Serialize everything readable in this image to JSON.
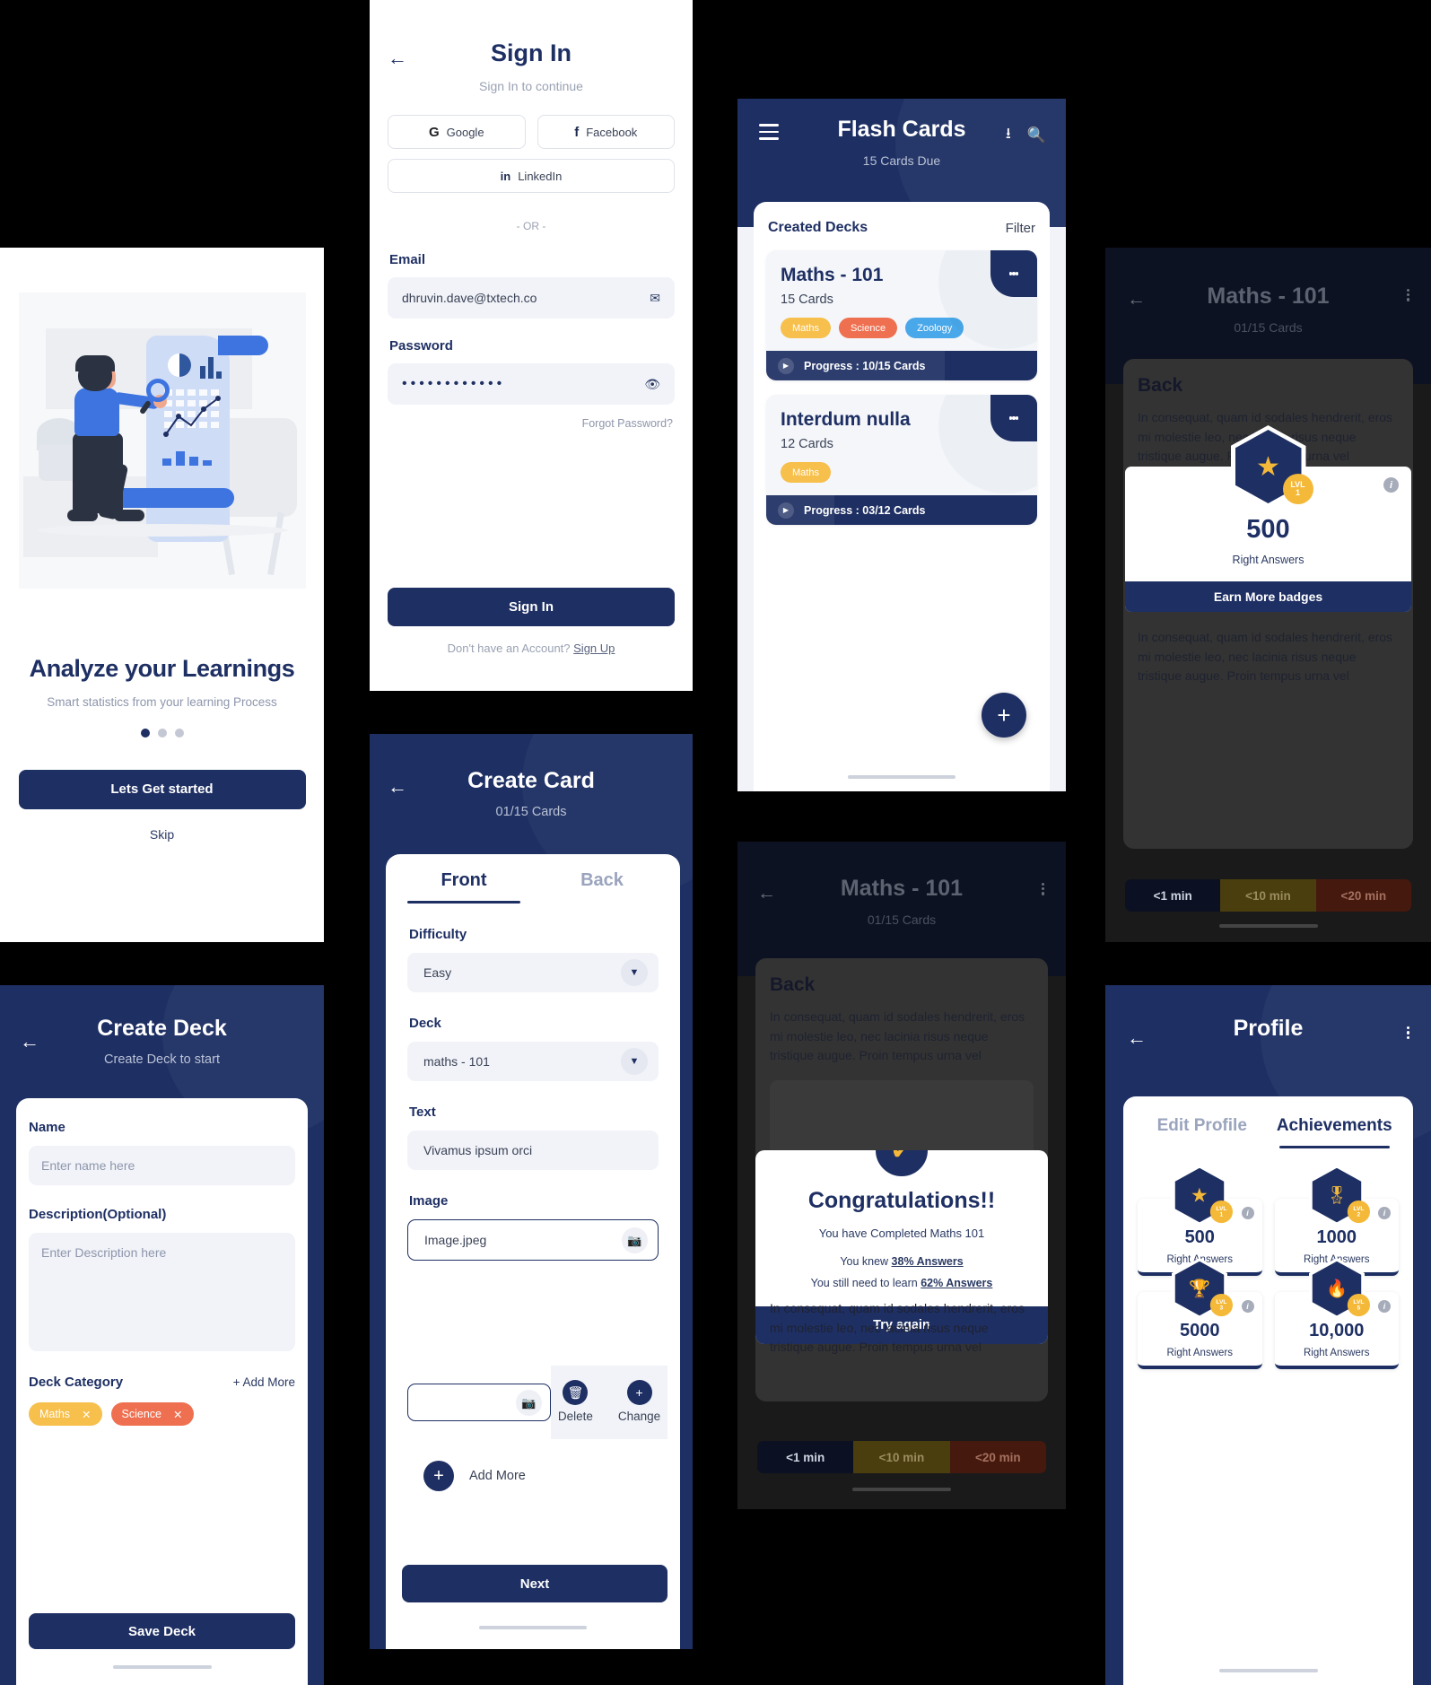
{
  "colors": {
    "navy": "#1e2f63",
    "yellow": "#f5b93a",
    "orange": "#ef7050",
    "blue": "#49a8ea",
    "light_bg": "#f1f3f8"
  },
  "onboarding": {
    "title": "Analyze your Learnings",
    "subtitle": "Smart statistics from your learning Process",
    "cta_label": "Lets Get started",
    "skip_label": "Skip",
    "dots": 3,
    "active_dot": 1
  },
  "signin": {
    "title": "Sign In",
    "subtitle": "Sign In to continue",
    "back_icon": "back-arrow-icon",
    "social": [
      {
        "label": "Google",
        "icon": "google-icon"
      },
      {
        "label": "Facebook",
        "icon": "facebook-icon"
      },
      {
        "label": "LinkedIn",
        "icon": "linkedin-icon"
      }
    ],
    "divider": "- OR -",
    "email_label": "Email",
    "email_value": "dhruvin.dave@txtech.co",
    "email_icon": "envelope-icon",
    "password_label": "Password",
    "password_value": "••••••••••••",
    "password_icon": "eye-icon",
    "forgot_label": "Forgot Password?",
    "submit_label": "Sign In",
    "footer_prefix": "Don't have an Account? ",
    "footer_link": "Sign Up"
  },
  "createcard": {
    "title": "Create Card",
    "subtitle": "01/15 Cards",
    "tabs": [
      {
        "label": "Front",
        "active": true
      },
      {
        "label": "Back",
        "active": false
      }
    ],
    "difficulty_label": "Difficulty",
    "difficulty_value": "Easy",
    "deck_label": "Deck",
    "deck_value": "maths - 101",
    "text_label": "Text",
    "text_value": "Vivamus ipsum orci",
    "image_label": "Image",
    "image_value": "Image.jpeg",
    "delete_label": "Delete",
    "change_label": "Change",
    "addmore_label": "Add More",
    "next_label": "Next"
  },
  "createdeck": {
    "title": "Create Deck",
    "subtitle": "Create Deck to start",
    "name_label": "Name",
    "name_placeholder": "Enter name here",
    "desc_label": "Description(Optional)",
    "desc_placeholder": "Enter Description here",
    "category_label": "Deck Category",
    "addmore_label": "+ Add More",
    "chips": [
      {
        "label": "Maths",
        "color": "#f7bf4b"
      },
      {
        "label": "Science",
        "color": "#ef7050"
      }
    ],
    "save_label": "Save Deck"
  },
  "flashcards": {
    "title": "Flash Cards",
    "subtitle": "15 Cards Due",
    "menu_icon": "hamburger-icon",
    "download_icon": "download-icon",
    "search_icon": "search-icon",
    "section_title": "Created Decks",
    "filter_label": "Filter",
    "fab_label": "+",
    "decks": [
      {
        "name": "Maths - 101",
        "count": "15 Cards",
        "tags": [
          {
            "label": "Maths",
            "color": "#f7bf4b"
          },
          {
            "label": "Science",
            "color": "#ef7050"
          },
          {
            "label": "Zoology",
            "color": "#49a8ea"
          }
        ],
        "progress_label": "Progress : 10/15 Cards",
        "progress_pct": 66
      },
      {
        "name": "Interdum nulla",
        "count": "12 Cards",
        "tags": [
          {
            "label": "Maths",
            "color": "#f7bf4b"
          }
        ],
        "progress_label": "Progress : 03/12 Cards",
        "progress_pct": 25
      }
    ]
  },
  "congrats": {
    "title": "Maths - 101",
    "subtitle": "01/15 Cards",
    "card_title": "Back",
    "card_text": "In consequat, quam id sodales hendrerit, eros mi molestie leo, nec lacinia risus neque tristique augue. Proin tempus urna vel",
    "bottom_text": "In consequat, quam id sodales hendrerit, eros mi molestie leo, nec lacinia risus neque tristique augue. Proin tempus urna vel",
    "check_icon": "check-icon",
    "heading": "Congratulations!!",
    "line1": "You have Completed Maths 101",
    "line2_prefix": "You knew ",
    "line2_value": "38% Answers",
    "line3_prefix": "You still need to learn ",
    "line3_value": "62% Answers",
    "try_again_label": "Try again",
    "time_chips": [
      {
        "label": "<1 min",
        "color": "#0b1022",
        "text": "#cfd4e2"
      },
      {
        "label": "<10 min",
        "color": "#4a3d0e",
        "text": "#9a8c5e"
      },
      {
        "label": "<20 min",
        "color": "#46190f",
        "text": "#a4705f"
      }
    ]
  },
  "badge": {
    "title": "Maths - 101",
    "subtitle": "01/15 Cards",
    "card_title": "Back",
    "card_text": "In consequat, quam id sodales hendrerit, eros mi molestie leo, nec lacinia risus neque tristique augue. Proin tempus urna vel",
    "bottom_text": "In consequat, quam id sodales hendrerit, eros mi molestie leo, nec lacinia risus neque tristique augue. Proin tempus urna vel",
    "badge_icon": "star-icon",
    "level_prefix": "LVL",
    "level_value": "1",
    "count": "500",
    "caption": "Right Answers",
    "earn_label": "Earn More badges",
    "info_icon": "info-icon",
    "time_chips": [
      {
        "label": "<1 min",
        "color": "#0b1022",
        "text": "#cfd4e2"
      },
      {
        "label": "<10 min",
        "color": "#4a3d0e",
        "text": "#9a8c5e"
      },
      {
        "label": "<20 min",
        "color": "#46190f",
        "text": "#a4705f"
      }
    ]
  },
  "profile": {
    "title": "Profile",
    "tabs": [
      {
        "label": "Edit Profile",
        "active": false
      },
      {
        "label": "Achievements",
        "active": true
      }
    ],
    "achievements": [
      {
        "count": "500",
        "caption": "Right Answers",
        "level": "1",
        "level_prefix": "LVL",
        "icon": "star-icon",
        "glyph": "★"
      },
      {
        "count": "1000",
        "caption": "Right Answers",
        "level": "2",
        "level_prefix": "LVL",
        "icon": "medal-icon",
        "glyph": "🎖"
      },
      {
        "count": "5000",
        "caption": "Right Answers",
        "level": "3",
        "level_prefix": "LVL",
        "icon": "trophy-icon",
        "glyph": "🏆"
      },
      {
        "count": "10,000",
        "caption": "Right Answers",
        "level": "5",
        "level_prefix": "LVL",
        "icon": "flame-icon",
        "glyph": "🔥"
      }
    ]
  }
}
